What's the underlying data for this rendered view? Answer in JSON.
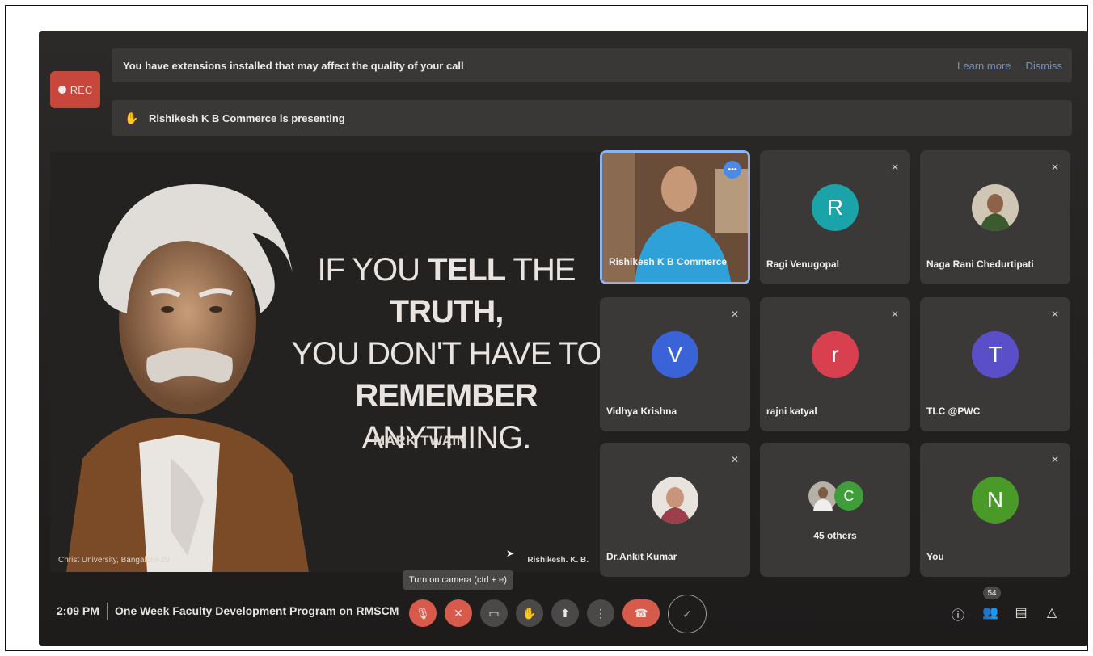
{
  "banner_extensions": {
    "message": "You have extensions installed that may affect the quality of your call",
    "learn_more": "Learn more",
    "dismiss": "Dismiss"
  },
  "rec_label": "REC",
  "presenting_banner": "Rishikesh K B Commerce is presenting",
  "slide": {
    "quote_line1_a": "IF YOU ",
    "quote_line1_b": "TELL",
    "quote_line1_c": " THE ",
    "quote_line1_d": "TRUTH,",
    "quote_line2": "YOU DON'T HAVE TO",
    "quote_line3_a": "REMEMBER",
    "quote_line3_b": " ANYTHING.",
    "author": "MARK TWAIN",
    "footer_left": "Christ University, Bangalore-29",
    "footer_right": "Rishikesh. K. B."
  },
  "participants": [
    {
      "name": "Rishikesh K B Commerce",
      "type": "video",
      "active": true
    },
    {
      "name": "Ragi Venugopal",
      "initial": "R",
      "color": "#1aa3a8",
      "muted": true
    },
    {
      "name": "Naga Rani Chedurtipati",
      "type": "photo",
      "muted": true
    },
    {
      "name": "Vidhya Krishna",
      "initial": "V",
      "color": "#3b63d8",
      "muted": true
    },
    {
      "name": "rajni katyal",
      "initial": "r",
      "color": "#d8404f",
      "muted": true
    },
    {
      "name": "TLC @PWC",
      "initial": "T",
      "color": "#5b4fc9",
      "muted": true
    },
    {
      "name": "Dr.Ankit Kumar",
      "type": "photo",
      "muted": true
    },
    {
      "name": "45 others",
      "initial": "C",
      "color": "#3f9e3a"
    },
    {
      "name": "You",
      "initial": "N",
      "color": "#4a9a2a",
      "muted": true
    }
  ],
  "bottom_bar": {
    "time": "2:09 PM",
    "meeting_title": "One Week Faculty Development Program on RMSCM",
    "tooltip": "Turn on camera (ctrl + e)",
    "participant_count": "54"
  }
}
